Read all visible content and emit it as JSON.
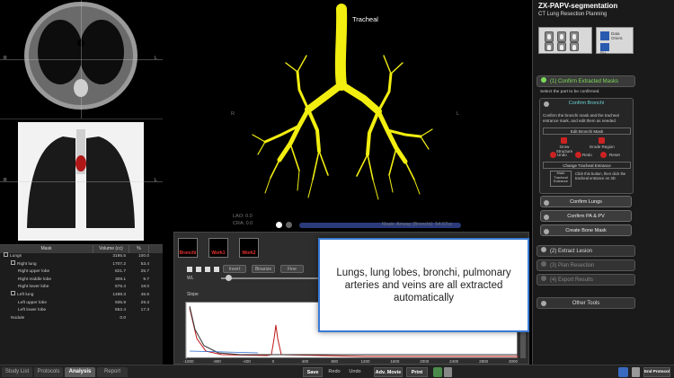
{
  "app": {
    "title": "ZX-PAPV-segmentation",
    "subtitle": "CT Lung Resection Planning"
  },
  "viewer3d": {
    "annotation": "Tracheal",
    "info_lao": "LAO: 0.0",
    "info_cra": "CRA: 0.0",
    "status": "Mask: Airway (Bronchi): 54.67cc",
    "orient_r": "R",
    "orient_l": "L",
    "axial_r": "R",
    "axial_l": "L",
    "coronal_r": "R",
    "coronal_l": "L"
  },
  "mask_table": {
    "headers": [
      "Mask",
      "Volume (cc)",
      "%"
    ],
    "rows": [
      {
        "label": "Lungs",
        "volume": "3195.5",
        "pct": "100.0",
        "indent": 0,
        "box": true
      },
      {
        "label": "Right lung",
        "volume": "1707.2",
        "pct": "53.4",
        "indent": 1,
        "box": true
      },
      {
        "label": "Right upper lobe",
        "volume": "821.7",
        "pct": "25.7",
        "indent": 2,
        "box": false
      },
      {
        "label": "Right middle lobe",
        "volume": "309.1",
        "pct": "9.7",
        "indent": 2,
        "box": false
      },
      {
        "label": "Right lower lobe",
        "volume": "576.4",
        "pct": "18.0",
        "indent": 2,
        "box": false
      },
      {
        "label": "Left lung",
        "volume": "1488.3",
        "pct": "46.6",
        "indent": 1,
        "box": true
      },
      {
        "label": "Left upper lobe",
        "volume": "935.9",
        "pct": "29.3",
        "indent": 2,
        "box": false
      },
      {
        "label": "Left lower lobe",
        "volume": "552.4",
        "pct": "17.3",
        "indent": 2,
        "box": false
      },
      {
        "label": "Nodule",
        "volume": "0.0",
        "pct": "",
        "indent": 1,
        "box": false
      }
    ]
  },
  "tabs": [
    "Study List",
    "Protocols",
    "Analysis",
    "Report"
  ],
  "toolbar": {
    "save": "Save",
    "redo": "Redo",
    "undo": "Undo",
    "adv_movie": "Adv. Movie",
    "print": "Print",
    "end_protocol": "End Protocol"
  },
  "tools": {
    "thumbs": [
      "Bronchi",
      "Work1",
      "Work2"
    ],
    "buttons": [
      "Invert",
      "Binarize",
      "Fine"
    ],
    "wl_label": "WL",
    "slope_label": "Slope"
  },
  "plot": {
    "x_ticks": [
      "-1000",
      "-800",
      "-400",
      "0",
      "400",
      "800",
      "1200",
      "1600",
      "2000",
      "2400",
      "2800",
      "3000"
    ]
  },
  "overlay": {
    "text": "Lungs, lung lobes, bronchi, pulmonary arteries and veins are all extracted automatically"
  },
  "right_panel": {
    "section1": "(1) Confirm Extracted Masks",
    "select_hint": "Select the part to be confirmed.",
    "confirm_bronchi": "Confirm Bronchi",
    "bronchi_desc": "Confirm the bronchi mask and the tracheal entrance mark, and edit them as needed.",
    "edit_bronchi_mask": "Edit Bronchi Mask",
    "grow_structure": "Grow Structure",
    "erode_region": "Erode Region",
    "undo": "Undo",
    "redo": "Redo",
    "reset": "Reset",
    "change_entrance": "Change Tracheal Entrance",
    "mark_entrance": "Mark Tracheal Entrance",
    "mark_hint": "Click this button, then click the tracheal entrance on 3D.",
    "confirm_lungs": "Confirm Lungs",
    "confirm_pa_pv": "Confirm PA & PV",
    "create_bone_mask": "Create Bone Mask",
    "section2": "(2) Extract Lesion",
    "section3": "(3) Plan Resection",
    "section4": "(4) Export Results",
    "other_tools": "Other Tools",
    "data_orient": "Data Orient.",
    "fill_label": "FILL"
  }
}
